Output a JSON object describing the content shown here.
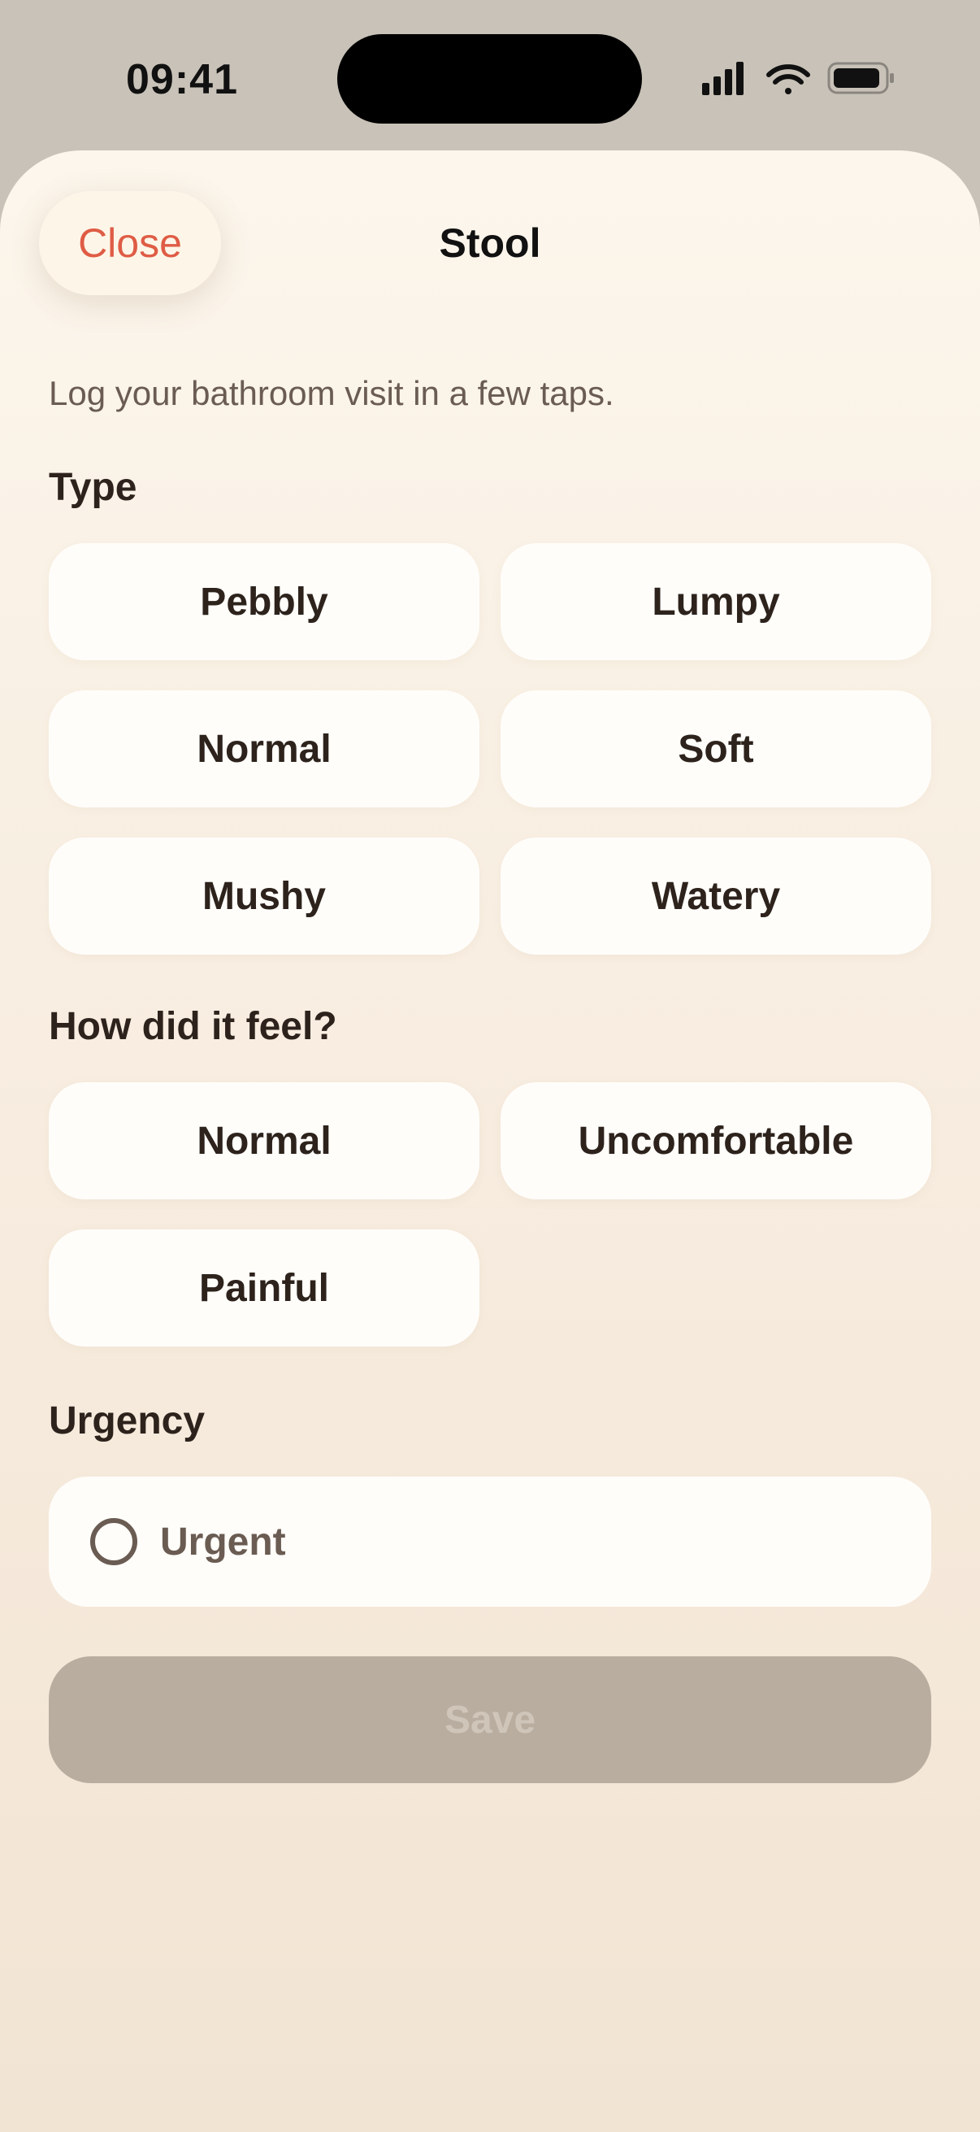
{
  "status_bar": {
    "time": "09:41",
    "icons": [
      "cellular-signal-icon",
      "wifi-icon",
      "battery-icon"
    ]
  },
  "header": {
    "close_label": "Close",
    "title": "Stool"
  },
  "subtitle": "Log your bathroom visit in a few taps.",
  "type_section": {
    "label": "Type",
    "options": [
      "Pebbly",
      "Lumpy",
      "Normal",
      "Soft",
      "Mushy",
      "Watery"
    ]
  },
  "feel_section": {
    "label": "How did it feel?",
    "options": [
      "Normal",
      "Uncomfortable",
      "Painful"
    ]
  },
  "urgency_section": {
    "label": "Urgency",
    "option_label": "Urgent",
    "selected": false
  },
  "save_label": "Save",
  "colors": {
    "accent_close": "#df5c45",
    "text_primary": "#2d231c",
    "text_secondary": "#6a5c52",
    "save_disabled_bg": "#b9ada0",
    "save_disabled_text": "#cfc5b9"
  }
}
